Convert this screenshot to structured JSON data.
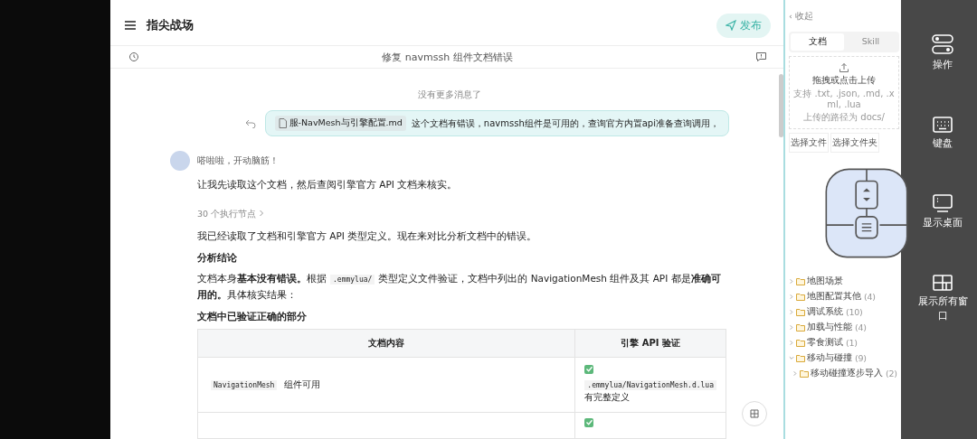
{
  "header": {
    "title": "指尖战场",
    "publish_button": "发布"
  },
  "subheader": {
    "title": "修复 navmssh 组件文档错误"
  },
  "chat": {
    "no_more": "没有更多消息了",
    "user_message": {
      "file": "服-NavMesh与引擎配置.md",
      "text": "这个文档有错误，navmssh组件是可用的，查询官方内置api准备查询调用，"
    },
    "assistant": {
      "name": "嗒啦啦，开动脑筋！",
      "blocks": [
        {
          "kind": "para",
          "segments": [
            {
              "kind": "text",
              "text": "让我先读取这个文档，然后查阅引擎官方 API 文档来核实。"
            }
          ]
        },
        {
          "kind": "nodes",
          "text": "30 个执行节点"
        },
        {
          "kind": "para",
          "segments": [
            {
              "kind": "text",
              "text": "我已经读取了文档和引擎官方 API 类型定义。现在来对比分析文档中的错误。"
            }
          ]
        },
        {
          "kind": "heading",
          "text": "分析结论"
        },
        {
          "kind": "para",
          "segments": [
            {
              "kind": "text",
              "text": "文档本身**基本没有错误。**根据"
            },
            {
              "kind": "code",
              "text": ".emmylua/"
            },
            {
              "kind": "text",
              "text": "类型定义文件验证，文档中列出的 NavigationMesh 组件及其 API 都是**准确可用的。**具体核实结果："
            }
          ]
        },
        {
          "kind": "heading",
          "text": "文档中已验证正确的部分"
        }
      ],
      "table": {
        "columns": [
          "文档内容",
          "引擎 API 验证"
        ],
        "rows": [
          {
            "content_code": "NavigationMesh",
            "content_text": "组件可用",
            "verified": true,
            "api_code": ".emmylua/NavigationMesh.d.lua",
            "api_text": "有完整定义"
          },
          {
            "verified": true
          }
        ]
      }
    }
  },
  "right_panel": {
    "collapse": "‹ 收起",
    "tabs": [
      {
        "label": "文档",
        "selected": true
      },
      {
        "label": "Skill",
        "selected": false
      }
    ],
    "upload": {
      "title": "拖拽或点击上传",
      "hint": "支持 .txt, .json, .md, .xml, .lua",
      "path": "上传的路径为 docs/"
    },
    "buttons": [
      "选择文件",
      "选择文件夹"
    ],
    "tree": [
      {
        "name": "地图场景",
        "expanded": false
      },
      {
        "name": "地图配置其他",
        "count": "(4)",
        "expanded": false
      },
      {
        "name": "调试系统",
        "count": "(10)",
        "expanded": false
      },
      {
        "name": "加载与性能",
        "count": "(4)",
        "expanded": false
      },
      {
        "name": "零食测试",
        "count": "(1)",
        "expanded": false
      },
      {
        "name": "移动与碰撞",
        "count": "(9)",
        "expanded": true,
        "children": [
          {
            "name": "移动碰撞逐步导入",
            "count": "(2)",
            "expanded": false
          }
        ]
      }
    ]
  },
  "side_bar": [
    {
      "kind": "toggle",
      "label": "操作"
    },
    {
      "kind": "keyboard",
      "label": "键盘"
    },
    {
      "kind": "desktop",
      "label": "显示桌面"
    },
    {
      "kind": "windows",
      "label": "展示所有窗口"
    }
  ]
}
